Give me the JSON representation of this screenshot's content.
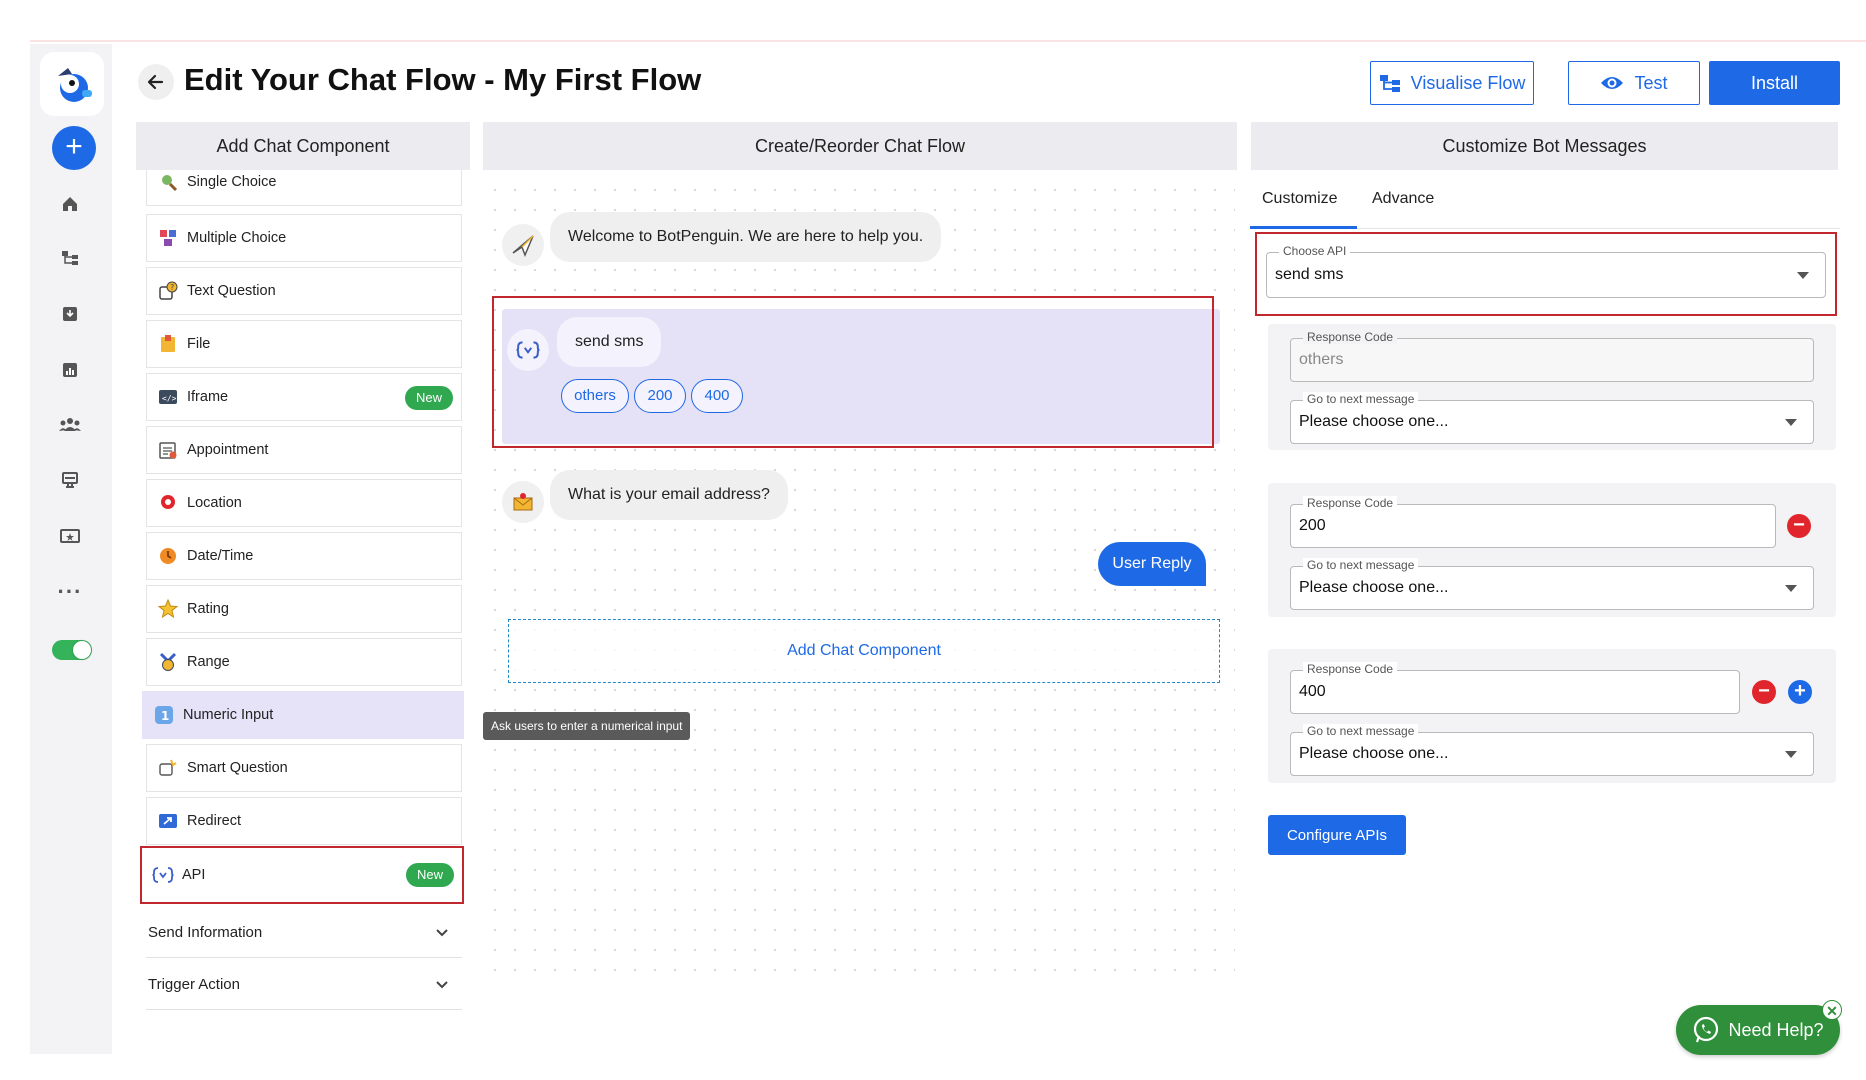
{
  "header": {
    "title": "Edit Your Chat Flow - My First Flow",
    "visualise_label": "Visualise Flow",
    "test_label": "Test",
    "install_label": "Install"
  },
  "columns": {
    "left": "Add Chat Component",
    "middle": "Create/Reorder Chat Flow",
    "right": "Customize Bot Messages"
  },
  "components": [
    {
      "label": "Single Choice",
      "icon": "single-choice-icon"
    },
    {
      "label": "Multiple Choice",
      "icon": "multiple-choice-icon"
    },
    {
      "label": "Text Question",
      "icon": "text-question-icon"
    },
    {
      "label": "File",
      "icon": "file-icon"
    },
    {
      "label": "Iframe",
      "icon": "iframe-icon",
      "badge": "New"
    },
    {
      "label": "Appointment",
      "icon": "appointment-icon"
    },
    {
      "label": "Location",
      "icon": "location-icon"
    },
    {
      "label": "Date/Time",
      "icon": "date-time-icon"
    },
    {
      "label": "Rating",
      "icon": "rating-icon"
    },
    {
      "label": "Range",
      "icon": "range-icon"
    },
    {
      "label": "Numeric Input",
      "icon": "numeric-input-icon"
    },
    {
      "label": "Smart Question",
      "icon": "smart-question-icon"
    },
    {
      "label": "Redirect",
      "icon": "redirect-icon"
    },
    {
      "label": "API",
      "icon": "api-icon",
      "badge": "New"
    }
  ],
  "sections": {
    "send_information": "Send Information",
    "trigger_action": "Trigger Action"
  },
  "tooltip": "Ask users to enter a numerical input",
  "flow": {
    "welcome": "Welcome to BotPenguin. We are here to help you.",
    "api_message": "send sms",
    "api_chips": [
      "others",
      "200",
      "400"
    ],
    "email_question": "What is your email address?",
    "user_reply": "User Reply",
    "add_component": "Add Chat Component"
  },
  "customize": {
    "tabs": [
      "Customize",
      "Advance"
    ],
    "choose_api_label": "Choose API",
    "choose_api_value": "send sms",
    "response_code_label": "Response Code",
    "next_message_label": "Go to next message",
    "next_message_value": "Please choose one...",
    "responses": [
      {
        "code_placeholder": "others"
      },
      {
        "code": "200"
      },
      {
        "code": "400"
      }
    ],
    "configure_label": "Configure APIs"
  },
  "help": {
    "label": "Need Help?"
  },
  "colors": {
    "accent": "#1e6ae6",
    "highlight": "#c0282d",
    "new_badge": "#2fa84f",
    "help": "#2f8f3a"
  }
}
